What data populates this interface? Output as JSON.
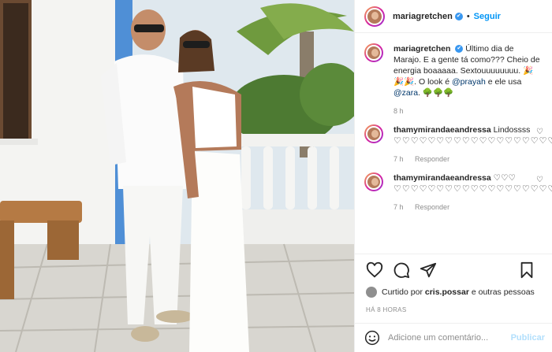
{
  "post": {
    "username": "mariagretchen",
    "follow_label": "Seguir",
    "separator": "•"
  },
  "caption": {
    "username": "mariagretchen",
    "text": "Último dia de Marajo. E a gente tá como??? Cheio de energia boaaaaa. Sextouuuuuuuu. 🎉🎉🎉. O look é",
    "mention1": "@prayah",
    "middle": "e ele usa",
    "mention2": "@zara",
    "end": ". 🌳🌳🌳",
    "time": "8 h"
  },
  "comments": [
    {
      "username": "thamymirandaeandressa",
      "text": "Lindossss",
      "hearts": "♡♡♡♡♡♡♡♡♡♡♡♡♡♡♡♡♡♡♡♡♡♡",
      "time": "7 h",
      "reply": "Responder"
    },
    {
      "username": "thamymirandaeandressa",
      "text": "♡♡♡",
      "hearts": "♡♡♡♡♡♡♡♡♡♡♡♡♡♡♡♡♡♡♡♡♡♡♡♡",
      "time": "7 h",
      "reply": "Responder"
    }
  ],
  "likes": {
    "prefix": "Curtido por",
    "user": "cris.possar",
    "suffix": "e outras pessoas"
  },
  "timestamp": "HÁ 8 HORAS",
  "add_comment": {
    "placeholder": "Adicione um comentário...",
    "publish_label": "Publicar"
  },
  "colors": {
    "accent": "#0095f6",
    "publish_disabled": "#b2dffc",
    "mention": "#00376b",
    "muted": "#8e8e8e"
  },
  "icons": [
    "verified-badge-icon",
    "heart-icon",
    "comment-icon",
    "share-icon",
    "bookmark-icon",
    "emoji-icon"
  ]
}
